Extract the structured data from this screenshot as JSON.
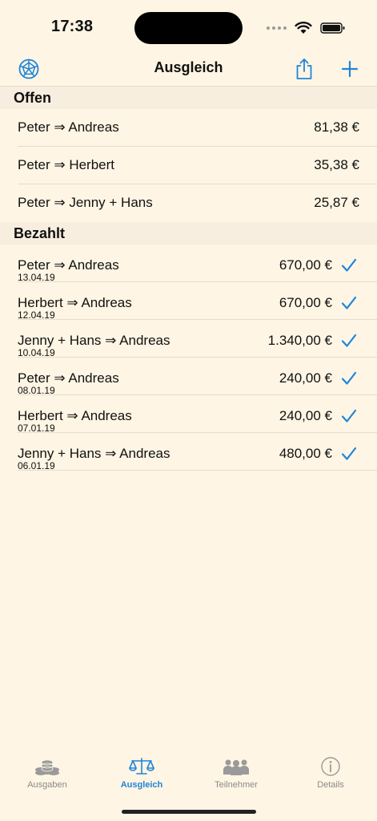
{
  "status": {
    "time": "17:38"
  },
  "nav": {
    "title": "Ausgleich"
  },
  "colors": {
    "accent": "#1F85D8",
    "background": "#FEF5E4",
    "section_bg": "#F8EEDF"
  },
  "sections": {
    "open": {
      "title": "Offen",
      "rows": [
        {
          "label": "Peter ⇒ Andreas",
          "amount": "81,38 €"
        },
        {
          "label": "Peter ⇒ Herbert",
          "amount": "35,38 €"
        },
        {
          "label": "Peter ⇒ Jenny + Hans",
          "amount": "25,87 €"
        }
      ]
    },
    "paid": {
      "title": "Bezahlt",
      "rows": [
        {
          "label": "Peter ⇒ Andreas",
          "date": "13.04.19",
          "amount": "670,00 €"
        },
        {
          "label": "Herbert ⇒ Andreas",
          "date": "12.04.19",
          "amount": "670,00 €"
        },
        {
          "label": "Jenny + Hans ⇒ Andreas",
          "date": "10.04.19",
          "amount": "1.340,00 €"
        },
        {
          "label": "Peter ⇒ Andreas",
          "date": "08.01.19",
          "amount": "240,00 €"
        },
        {
          "label": "Herbert ⇒ Andreas",
          "date": "07.01.19",
          "amount": "240,00 €"
        },
        {
          "label": "Jenny + Hans ⇒ Andreas",
          "date": "06.01.19",
          "amount": "480,00 €"
        }
      ]
    }
  },
  "tabs": [
    {
      "label": "Ausgaben",
      "icon": "coins-icon",
      "active": false
    },
    {
      "label": "Ausgleich",
      "icon": "scale-icon",
      "active": true
    },
    {
      "label": "Teilnehmer",
      "icon": "people-icon",
      "active": false
    },
    {
      "label": "Details",
      "icon": "info-icon",
      "active": false
    }
  ]
}
